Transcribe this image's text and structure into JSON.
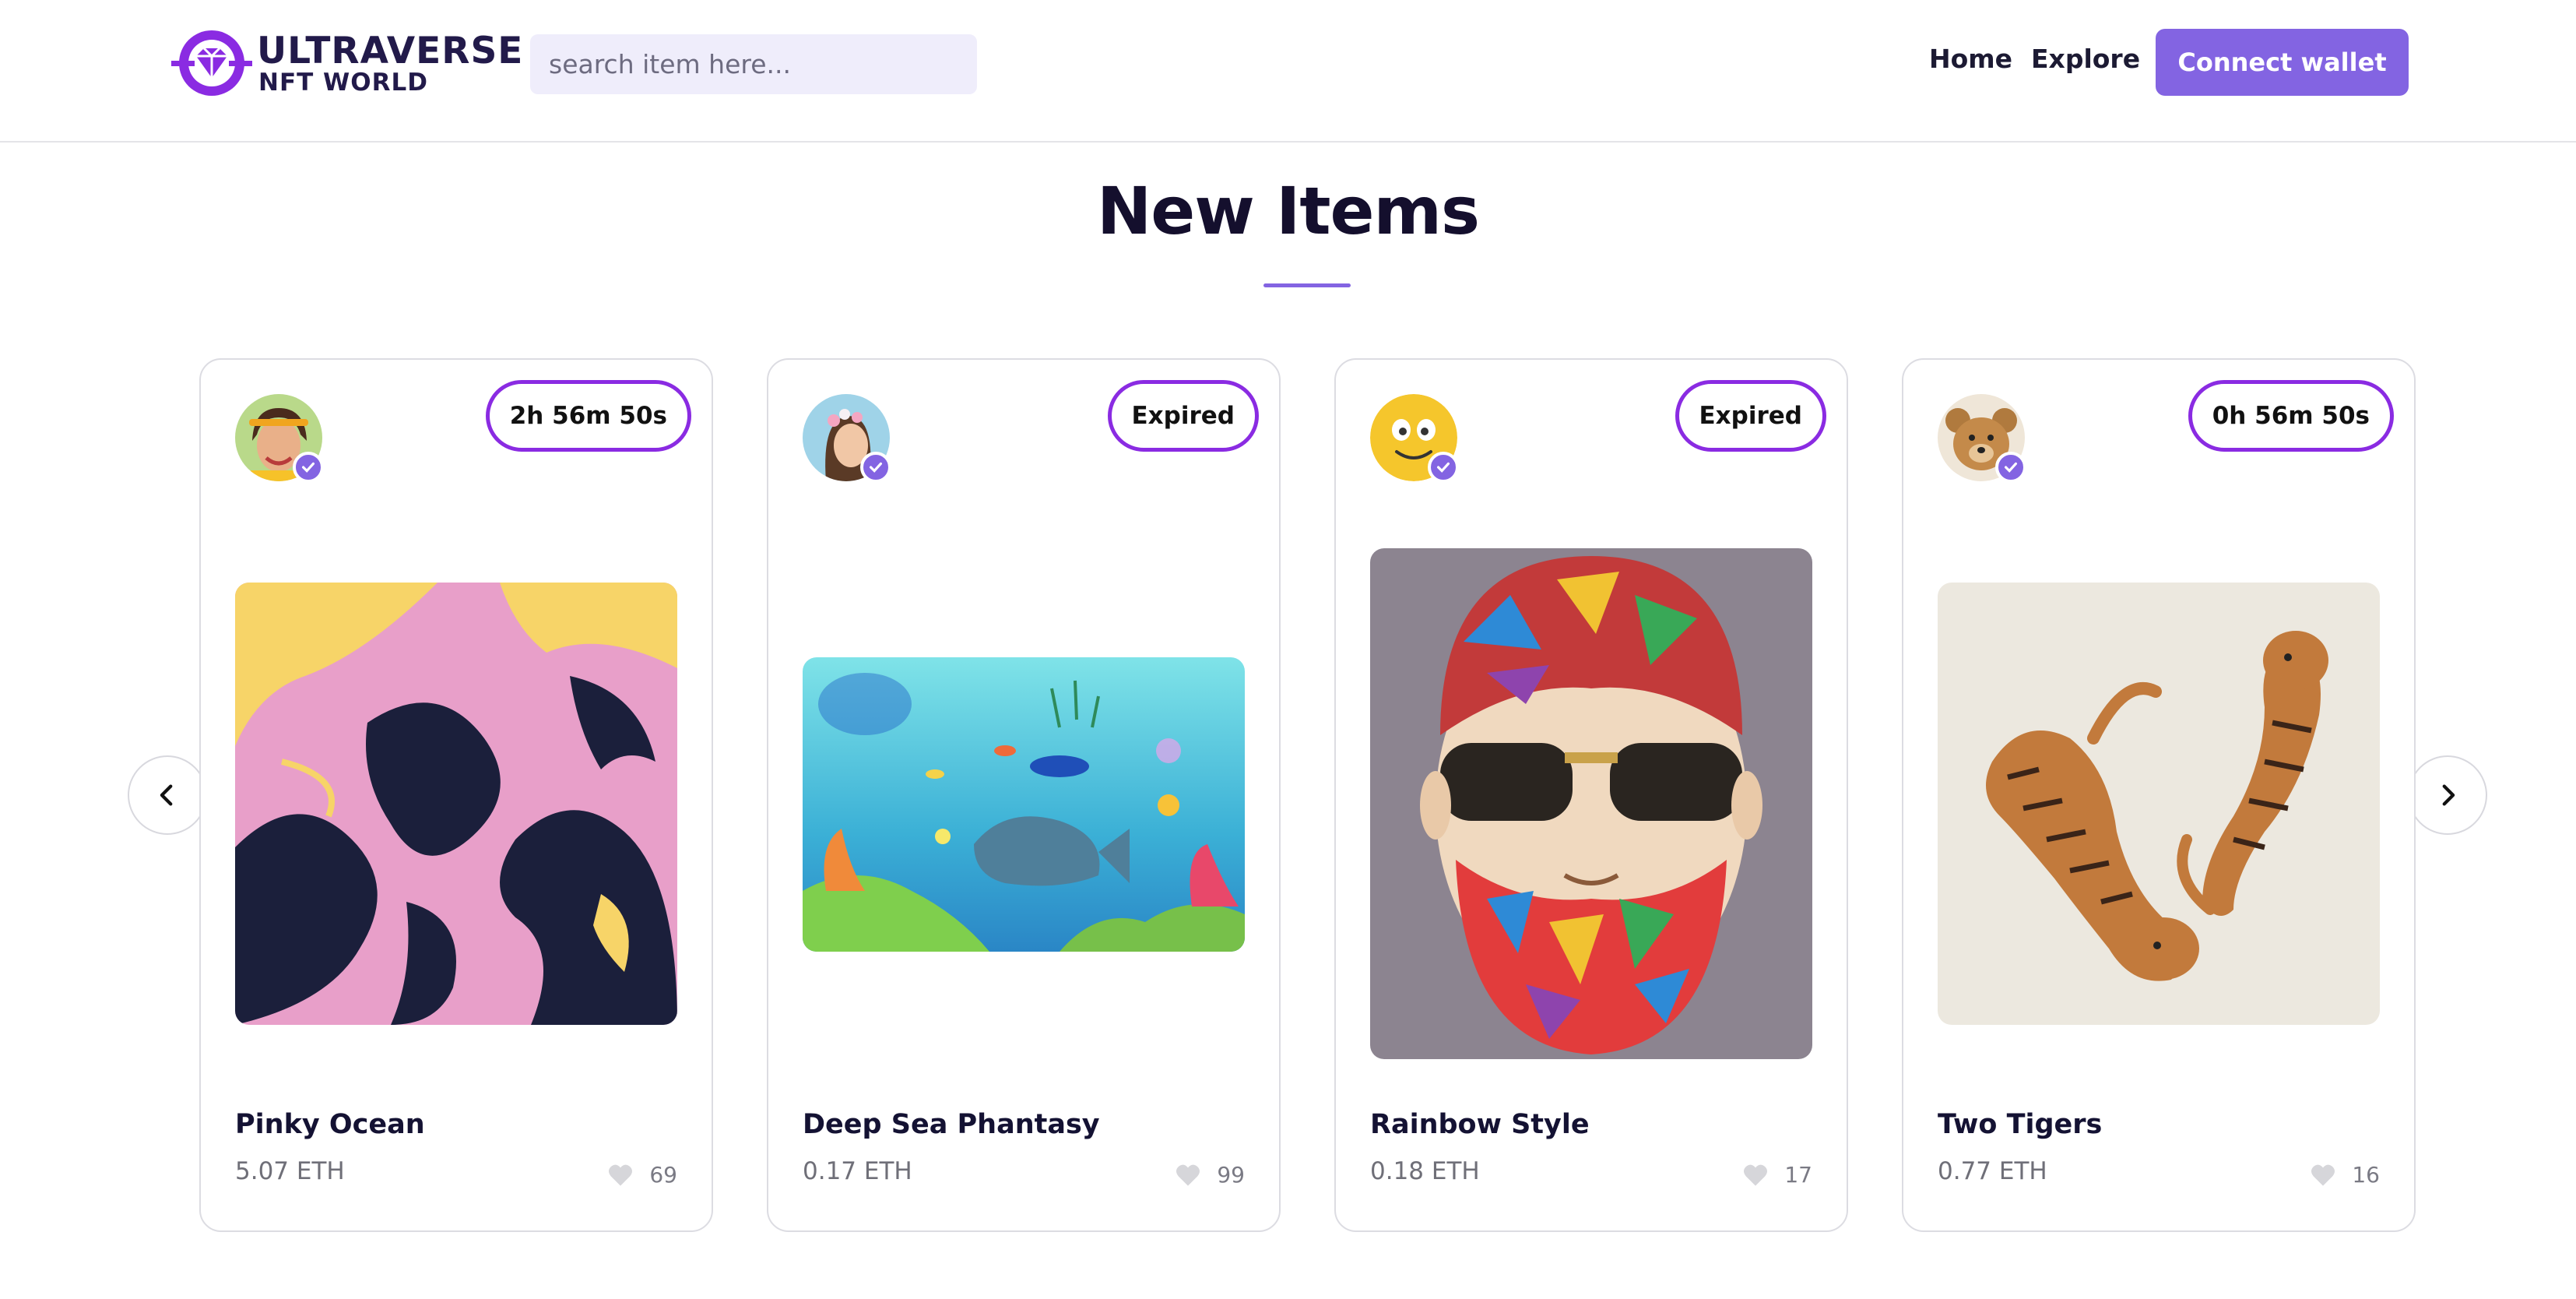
{
  "header": {
    "logo_line1": "ULTRAVERSE",
    "logo_line2": "NFT WORLD",
    "search_placeholder": "search item here...",
    "nav": [
      "Home",
      "Explore"
    ],
    "wallet_button": "Connect wallet"
  },
  "section": {
    "title": "New Items"
  },
  "colors": {
    "accent": "#8364e2",
    "timer_border": "#8a2be2"
  },
  "icons": {
    "prev": "chevron-left-icon",
    "next": "chevron-right-icon",
    "like": "heart-icon",
    "verified": "check-icon"
  },
  "items": [
    {
      "name": "Pinky Ocean",
      "price": "5.07 ETH",
      "likes": "69",
      "timer": "2h 56m 50s"
    },
    {
      "name": "Deep Sea Phantasy",
      "price": "0.17 ETH",
      "likes": "99",
      "timer": "Expired"
    },
    {
      "name": "Rainbow Style",
      "price": "0.18 ETH",
      "likes": "17",
      "timer": "Expired"
    },
    {
      "name": "Two Tigers",
      "price": "0.77 ETH",
      "likes": "16",
      "timer": "0h 56m 50s"
    }
  ]
}
